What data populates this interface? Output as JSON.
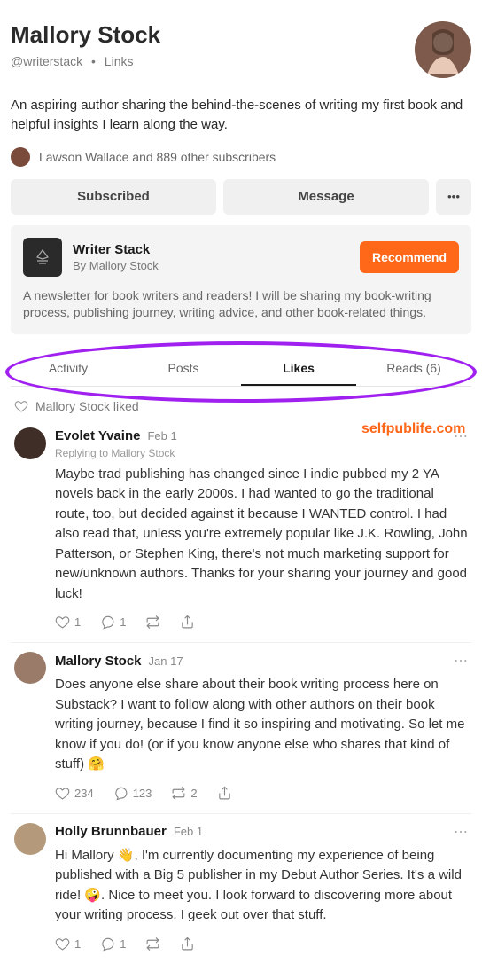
{
  "profile": {
    "name": "Mallory Stock",
    "handle": "@writerstack",
    "links_label": "Links",
    "dot": "•",
    "bio": "An aspiring author sharing the behind-the-scenes of writing my first book and helpful insights I learn along the way.",
    "subscribers_text": "Lawson Wallace and 889 other subscribers"
  },
  "actions": {
    "subscribed": "Subscribed",
    "message": "Message",
    "more": "•••"
  },
  "newsletter": {
    "title": "Writer Stack",
    "author": "By Mallory Stock",
    "recommend": "Recommend",
    "description": "A newsletter for book writers and readers! I will be sharing my book-writing process, publishing journey, writing advice, and other book-related things."
  },
  "tabs": [
    {
      "label": "Activity",
      "active": false
    },
    {
      "label": "Posts",
      "active": false
    },
    {
      "label": "Likes",
      "active": true
    },
    {
      "label": "Reads (6)",
      "active": false
    }
  ],
  "liked_label": "Mallory Stock liked",
  "posts": [
    {
      "author": "Evolet Yvaine",
      "date": "Feb 1",
      "reply_to": "Replying to Mallory Stock",
      "body": "Maybe trad publishing has changed since I indie pubbed my 2 YA novels back in the early 2000s. I had wanted to go the traditional route, too, but decided against it because I WANTED control. I had also read that, unless you're extremely popular like J.K. Rowling, John Patterson, or Stephen King, there's not much marketing support for new/unknown authors. Thanks for your sharing your journey and good luck!",
      "likes": "1",
      "comments": "1",
      "restacks": "",
      "avatar_color": "#3f2e28"
    },
    {
      "author": "Mallory Stock",
      "date": "Jan 17",
      "reply_to": "",
      "body": "Does anyone else share about their book writing process here on Substack? I want to follow along with other authors on their book writing journey, because I find it so inspiring and motivating. So let me know if you do! (or if you know anyone else who shares that kind of stuff) 🤗",
      "likes": "234",
      "comments": "123",
      "restacks": "2",
      "avatar_color": "#9a7a68"
    },
    {
      "author": "Holly Brunnbauer",
      "date": "Feb 1",
      "reply_to": "",
      "body": "Hi Mallory 👋, I'm currently documenting my experience of being published with a Big 5 publisher in my Debut Author Series. It's a wild ride! 🤪. Nice to meet you. I look forward to discovering more about your writing process. I geek out over that stuff.",
      "likes": "1",
      "comments": "1",
      "restacks": "",
      "avatar_color": "#b49a7a"
    }
  ],
  "watermark": "selfpublife.com"
}
